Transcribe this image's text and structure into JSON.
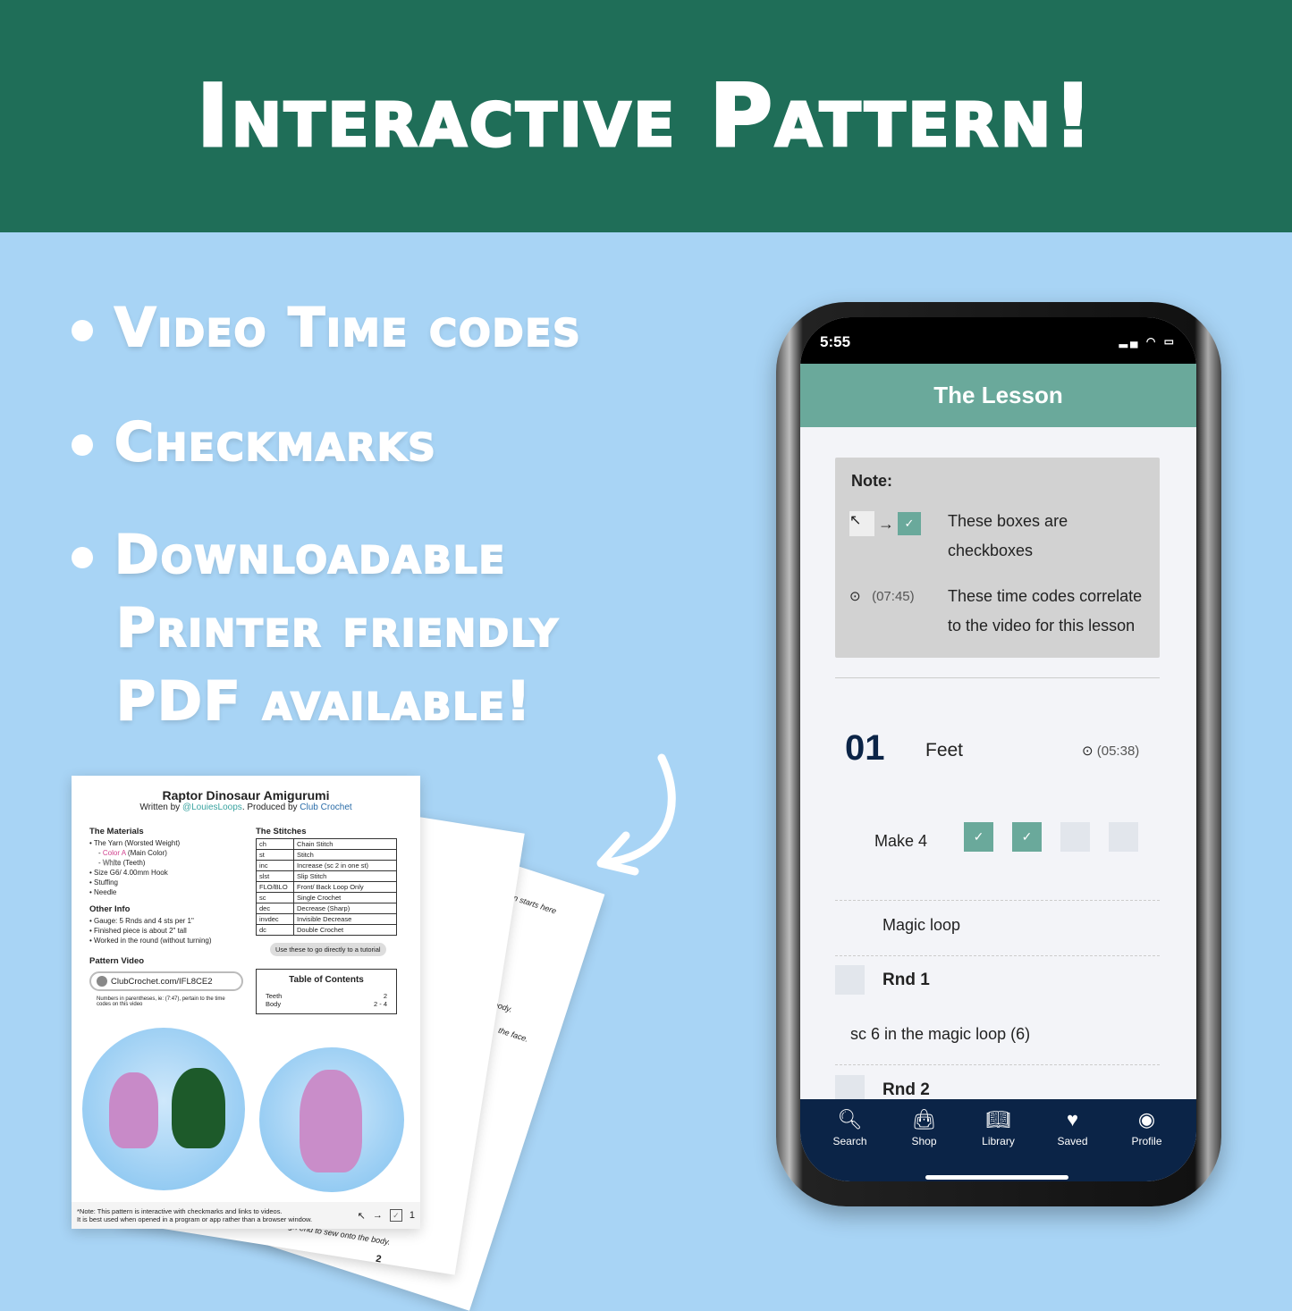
{
  "banner": {
    "title": "Interactive Pattern!"
  },
  "features": [
    "Video Time codes",
    "Checkmarks",
    "Downloadable",
    "Printer friendly",
    "PDF available!"
  ],
  "pdf": {
    "back_pages": {
      "p3_text": "Pattern starts here",
      "p3_body": "body.",
      "p3_face": "the face.",
      "p2_text": "...gh leaving a long enough end to sew onto the body.",
      "p2_number": "2"
    },
    "title": "Raptor Dinosaur Amigurumi",
    "byline": {
      "written_by": "Written by ",
      "author": "@LouiesLoops",
      "produced_by": ". Produced by ",
      "producer": "Club Crochet"
    },
    "materials": {
      "heading": "The Materials",
      "yarn": "• The Yarn (Worsted Weight)",
      "color_a": "Color A",
      "color_a_note": " (Main Color)",
      "white": "White",
      "white_note": " (Teeth)",
      "items": [
        "• Size G6/ 4.00mm Hook",
        "• Stuffing",
        "• Needle"
      ]
    },
    "other_info": {
      "heading": "Other Info",
      "items": [
        "• Gauge: 5 Rnds and 4 sts per 1\"",
        "• Finished piece is about 2\" tall",
        "• Worked in the round (without turning)"
      ]
    },
    "pattern_video": {
      "heading": "Pattern Video",
      "link": "ClubCrochet.com/IFL8CE2",
      "note": "Numbers in parentheses, ie: (7:47), pertain to the time codes on this video"
    },
    "stitches": {
      "heading": "The Stitches",
      "rows": [
        [
          "ch",
          "Chain Stitch"
        ],
        [
          "st",
          "Stitch"
        ],
        [
          "inc",
          "Increase (sc 2 in one st)"
        ],
        [
          "slst",
          "Slip Stitch"
        ],
        [
          "FLO/BLO",
          "Front/ Back Loop Only"
        ],
        [
          "sc",
          "Single Crochet"
        ],
        [
          "dec",
          "Decrease (Sharp)"
        ],
        [
          "invdec",
          "Invisible Decrease"
        ],
        [
          "dc",
          "Double Crochet"
        ]
      ],
      "tip": "Use these to go directly to a tutorial"
    },
    "toc": {
      "heading": "Table of Contents",
      "rows": [
        [
          "Teeth",
          "2"
        ],
        [
          "Body",
          "2 - 4"
        ]
      ]
    },
    "footer": {
      "note_line1": "*Note: This pattern is interactive with checkmarks and links to videos.",
      "note_line2": "It is best used when opened in a program or app rather than a browser window.",
      "page": "1"
    }
  },
  "phone": {
    "status": {
      "time": "5:55"
    },
    "header": "The Lesson",
    "note": {
      "heading": "Note:",
      "checkbox_text": "These boxes are checkboxes",
      "timecode": "(07:45)",
      "timecode_text": "These time codes correlate to the video for this lesson"
    },
    "section": {
      "number": "01",
      "title": "Feet",
      "timecode": "(05:38)",
      "make_label": "Make 4",
      "checks": [
        true,
        true,
        false,
        false
      ]
    },
    "steps": [
      {
        "text": "Magic loop"
      },
      {
        "label": "Rnd 1"
      },
      {
        "text": "sc 6 in the magic loop (6)"
      },
      {
        "label": "Rnd 2"
      }
    ],
    "nav": [
      {
        "label": "Search",
        "icon": "search-icon"
      },
      {
        "label": "Shop",
        "icon": "shop-bag-icon"
      },
      {
        "label": "Library",
        "icon": "book-icon"
      },
      {
        "label": "Saved",
        "icon": "heart-icon"
      },
      {
        "label": "Profile",
        "icon": "profile-icon"
      }
    ]
  },
  "colors": {
    "banner": "#1f6e58",
    "background": "#a8d4f5",
    "accent": "#6aa99b",
    "nav": "#0b2447"
  }
}
